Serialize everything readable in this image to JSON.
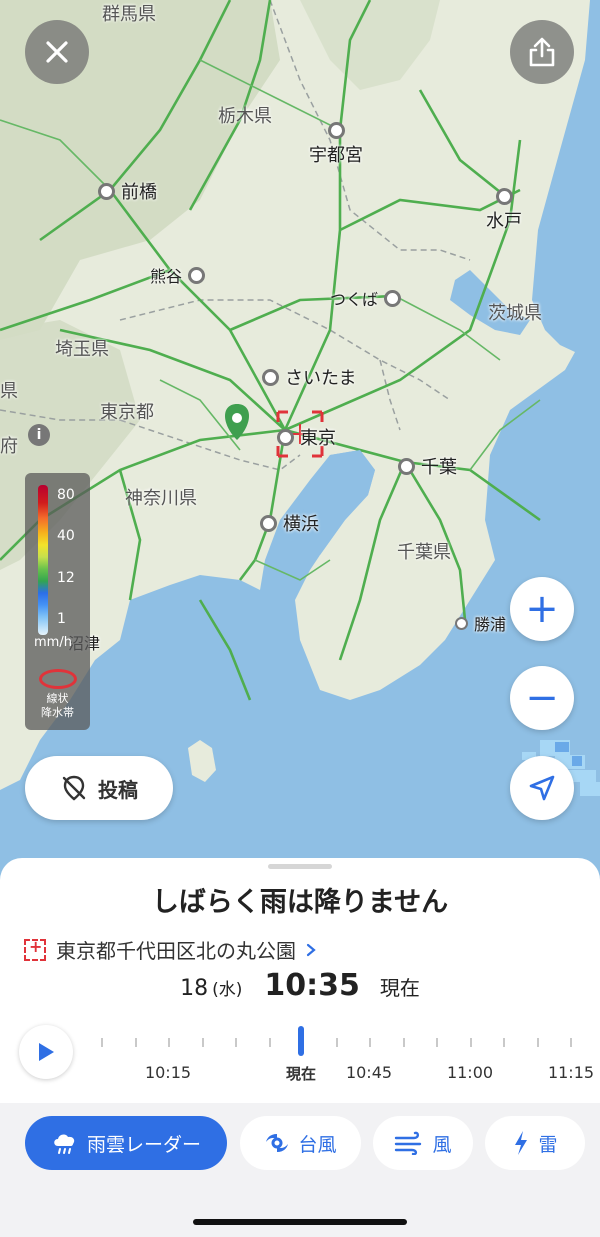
{
  "map": {
    "labels": {
      "gunma": "群馬県",
      "tochigi": "栃木県",
      "saitama_pref": "埼玉県",
      "ibaraki": "茨城県",
      "tokyo_pref": "東京都",
      "kanagawa": "神奈川県",
      "chiba_pref": "千葉県",
      "yamanashi_fu": "府",
      "yamanashi_ken": "県"
    },
    "cities": {
      "maebashi": "前橋",
      "utsunomiya": "宇都宮",
      "mito": "水戸",
      "kumagaya": "熊谷",
      "tsukuba": "つくば",
      "saitama": "さいたま",
      "tokyo": "東京",
      "chiba": "千葉",
      "yokohama": "横浜",
      "katsuura": "勝浦",
      "numazu": "沼津"
    },
    "info_icon": "i"
  },
  "controls": {
    "close_icon": "close-icon",
    "share_icon": "share-icon",
    "zoom_in": "+",
    "zoom_out": "−",
    "locate_icon": "navigation-arrow-icon",
    "post_label": "投稿"
  },
  "legend": {
    "ticks": [
      "80",
      "40",
      "12",
      "1"
    ],
    "unit": "mm/h",
    "linear_band_line1": "線状",
    "linear_band_line2": "降水帯"
  },
  "sheet": {
    "status": "しばらく雨は降りません",
    "location": "東京都千代田区北の丸公園",
    "date": "18",
    "weekday": "(水)",
    "time": "10:35",
    "now_label": "現在",
    "timeline_labels": [
      "10:15",
      "現在",
      "10:45",
      "11:00",
      "11:15"
    ]
  },
  "tabs": [
    {
      "label": "雨雲レーダー",
      "icon": "rain-cloud-icon",
      "active": true
    },
    {
      "label": "台風",
      "icon": "typhoon-icon",
      "active": false
    },
    {
      "label": "風",
      "icon": "wind-icon",
      "active": false
    },
    {
      "label": "雷",
      "icon": "lightning-icon",
      "active": false
    }
  ],
  "colors": {
    "accent": "#2f6fe4",
    "land": "#e7ebdc",
    "sea": "#8fbfe4",
    "rail": "#4fae4f",
    "radar_marker": "#e0333a",
    "pin": "#3f9f4f"
  }
}
